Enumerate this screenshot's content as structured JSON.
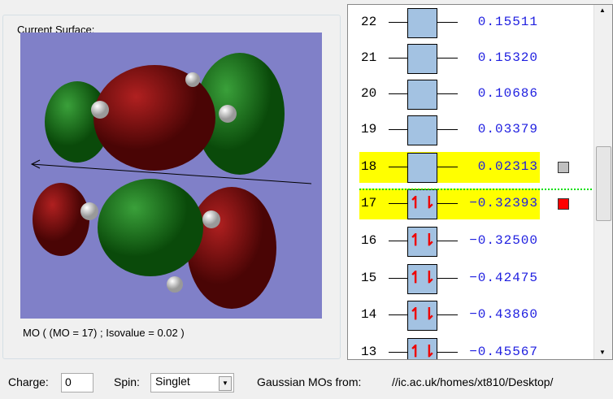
{
  "surface": {
    "title": "Current Surface:",
    "caption": "MO ( (MO = 17) ; Isovalue = 0.02 )"
  },
  "orbitals": [
    {
      "num": "22",
      "energy": "0.15511",
      "occupied": false,
      "highlight": false
    },
    {
      "num": "21",
      "energy": "0.15320",
      "occupied": false,
      "highlight": false
    },
    {
      "num": "20",
      "energy": "0.10686",
      "occupied": false,
      "highlight": false
    },
    {
      "num": "19",
      "energy": "0.03379",
      "occupied": false,
      "highlight": false
    },
    {
      "num": "18",
      "energy": "0.02313",
      "occupied": false,
      "highlight": true,
      "indicator": "#c0c0c0"
    },
    {
      "num": "17",
      "energy": "−0.32393",
      "occupied": true,
      "highlight": true,
      "indicator": "#ff0000"
    },
    {
      "num": "16",
      "energy": "−0.32500",
      "occupied": true,
      "highlight": false
    },
    {
      "num": "15",
      "energy": "−0.42475",
      "occupied": true,
      "highlight": false
    },
    {
      "num": "14",
      "energy": "−0.43860",
      "occupied": true,
      "highlight": false
    },
    {
      "num": "13",
      "energy": "−0.45567",
      "occupied": true,
      "highlight": false
    }
  ],
  "electron_pair": "↿⇂",
  "bottom": {
    "charge_label": "Charge:",
    "charge_value": "0",
    "spin_label": "Spin:",
    "spin_value": "Singlet",
    "source_label": "Gaussian MOs from:",
    "source_path": "//ic.ac.uk/homes/xt810/Desktop/"
  }
}
